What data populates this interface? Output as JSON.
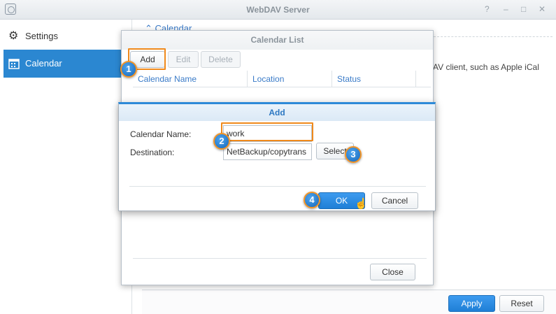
{
  "window": {
    "title": "WebDAV Server",
    "controls": [
      "?",
      "–",
      "□",
      "✕"
    ]
  },
  "sidebar": {
    "items": [
      {
        "label": "Settings",
        "icon": "gear-icon",
        "active": false
      },
      {
        "label": "Calendar",
        "icon": "calendar-icon",
        "active": true
      }
    ]
  },
  "main": {
    "section_header": "Calendar",
    "description_fragment": "AV client, such as Apple iCal",
    "apply_label": "Apply",
    "reset_label": "Reset"
  },
  "calendar_list_dialog": {
    "title": "Calendar List",
    "add_label": "Add",
    "edit_label": "Edit",
    "delete_label": "Delete",
    "columns": [
      "Calendar Name",
      "Location",
      "Status"
    ],
    "close_label": "Close"
  },
  "add_dialog": {
    "title": "Add",
    "calendar_name_label": "Calendar Name:",
    "calendar_name_value": "work",
    "destination_label": "Destination:",
    "destination_value": "NetBackup/copytrans",
    "select_label": "Select",
    "ok_label": "OK",
    "cancel_label": "Cancel"
  },
  "steps": [
    "1",
    "2",
    "3",
    "4"
  ],
  "colors": {
    "accent": "#2b87d1",
    "highlight": "#f08a1c"
  }
}
